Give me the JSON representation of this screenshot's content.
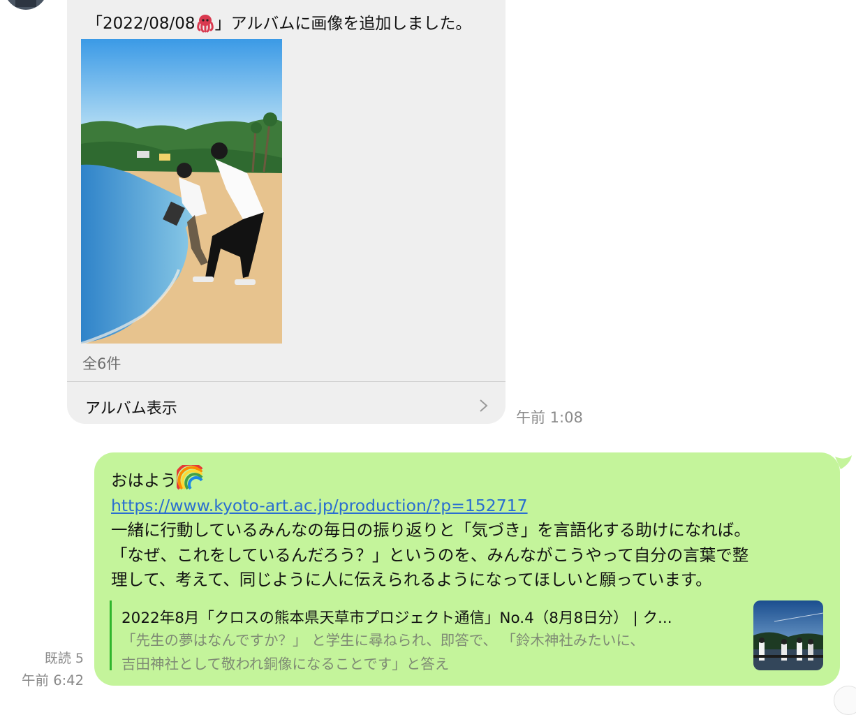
{
  "incoming": {
    "caption_prefix": "「2022/08/08",
    "caption_emoji": "octopus",
    "caption_suffix": "」アルバムに画像を追加しました。",
    "photo_count": "全6件",
    "view_album_label": "アルバム表示",
    "time": "午前 1:08"
  },
  "outgoing": {
    "greeting": "おはよう",
    "greeting_emoji": "rainbow",
    "url": "https://www.kyoto-art.ac.jp/production/?p=152717",
    "body_lines": [
      "一緒に行動しているみんなの毎日の振り返りと「気づき」を言語化する助けになれば。",
      "「なぜ、これをしているんだろう？」というのを、みんながこうやって自分の言葉で整",
      "理して、考えて、同じように人に伝えられるようになってほしいと願っています。"
    ],
    "preview": {
      "title": "2022年8月「クロスの熊本県天草市プロジェクト通信」No.4（8月8日分） | ク...",
      "desc_lines": [
        "「先生の夢はなんですか？」 と学生に尋ねられ、即答で、 「鈴木神社みたいに、",
        "吉田神社として敬われ銅像になることです」と答え"
      ]
    },
    "read_status": "既読 5",
    "time": "午前 6:42"
  },
  "colors": {
    "incoming_bubble": "#efefef",
    "outgoing_bubble": "#c4f49b",
    "link": "#2a6ed0",
    "preview_bar": "#2fb62c"
  }
}
